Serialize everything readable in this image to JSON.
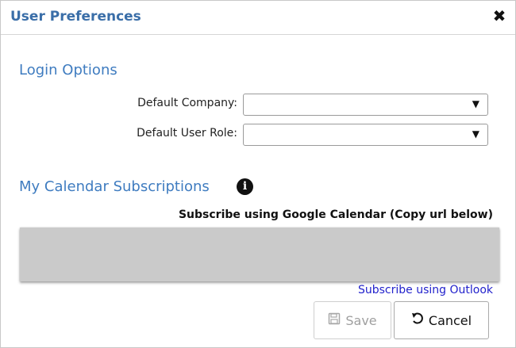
{
  "dialog": {
    "title": "User Preferences",
    "close_icon": "close-icon"
  },
  "login_options": {
    "heading": "Login Options",
    "default_company": {
      "label": "Default Company:",
      "value": ""
    },
    "default_user_role": {
      "label": "Default User Role:",
      "value": ""
    }
  },
  "calendar": {
    "heading": "My Calendar Subscriptions",
    "info_icon": "info-icon",
    "google_label": "Subscribe using Google Calendar (Copy url below)",
    "url_value": "",
    "outlook_link": "Subscribe using Outlook"
  },
  "buttons": {
    "save_label": "Save",
    "cancel_label": "Cancel"
  }
}
